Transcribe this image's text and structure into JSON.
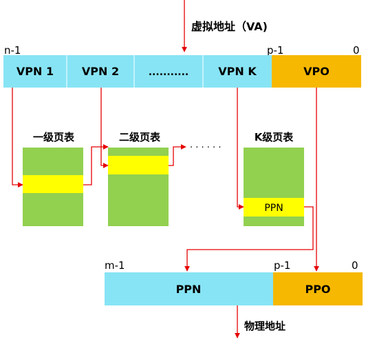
{
  "top_label": "虚拟地址（VA)",
  "va_bits": {
    "high": "n-1",
    "mid": "p-1",
    "low": "0"
  },
  "va_fields": [
    "VPN 1",
    "VPN 2",
    "...........",
    "VPN K",
    "VPO"
  ],
  "tables": {
    "first": "一级页表",
    "second": "二级页表",
    "dots": "·  ·  ·    ·  ·  ·",
    "last": "K级页表",
    "ppn_entry": "PPN"
  },
  "pa_bits": {
    "high": "m-1",
    "mid": "p-1",
    "low": "0"
  },
  "pa_fields": [
    "PPN",
    "PPO"
  ],
  "bottom_label": "物理地址",
  "colors": {
    "cyan": "#87E4F4",
    "orange": "#F6B800",
    "green": "#92D050",
    "yellow": "#FFFF00",
    "arrow": "#E60000"
  }
}
